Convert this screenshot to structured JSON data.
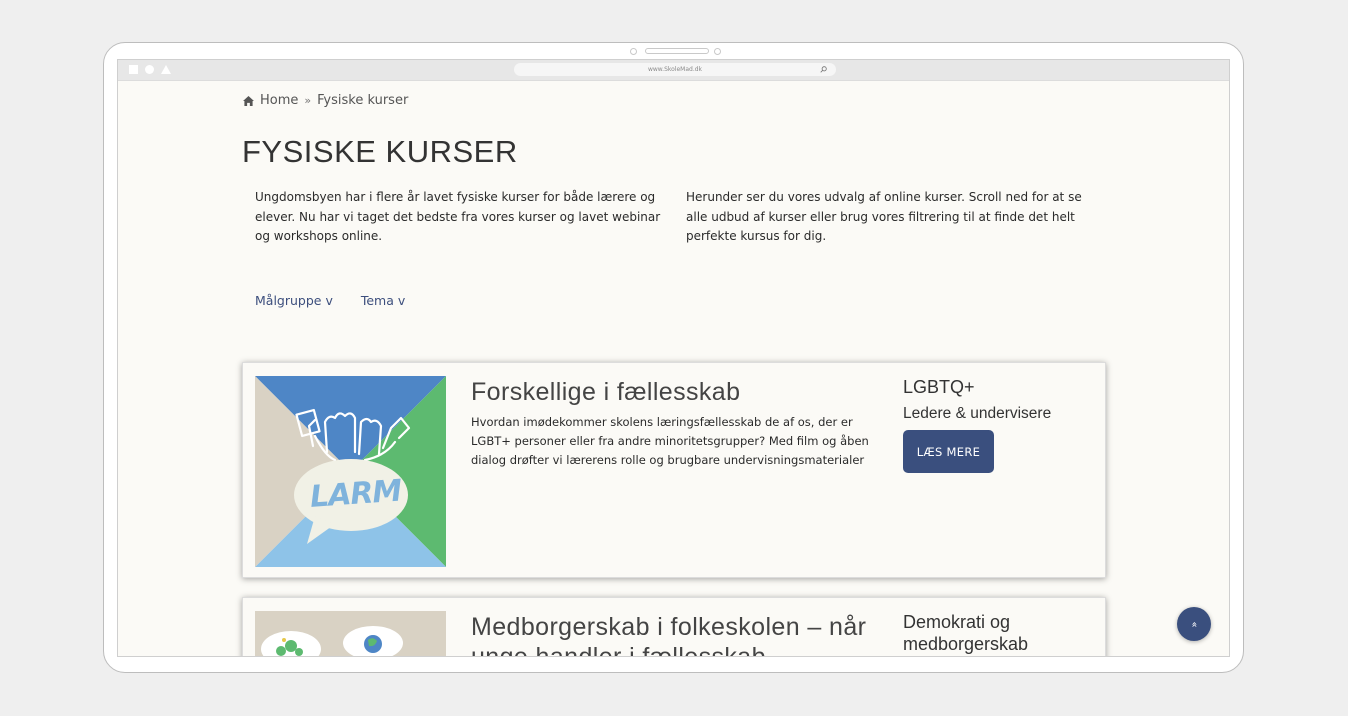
{
  "browser": {
    "url": "www.SkoleMad.dk"
  },
  "breadcrumb": {
    "home_label": "Home",
    "separator": "»",
    "current": "Fysiske kurser"
  },
  "page": {
    "title": "FYSISKE KURSER",
    "intro_left": "Ungdomsbyen har i flere år lavet fysiske kurser for både lærere og elever. Nu har vi taget det bedste fra vores kurser og lavet webinar og workshops online.",
    "intro_right": "Herunder ser du vores udvalg af online kurser. Scroll ned for at se alle udbud af kurser eller brug vores filtrering til at finde det helt perfekte kursus for dig."
  },
  "filters": [
    {
      "label": "Målgruppe v"
    },
    {
      "label": "Tema v"
    }
  ],
  "courses": [
    {
      "image_text": "LARM",
      "title": "Forskellige i fællesskab",
      "description": "Hvordan imødekommer skolens læringsfællesskab de af os, der er LGBT+ personer eller fra andre minoritetsgrupper? Med film og åben dialog drøfter vi lærerens rolle og brugbare undervisningsmaterialer",
      "tag": "LGBTQ+",
      "audience": "Ledere & undervisere",
      "button_label": "LÆS MERE"
    },
    {
      "title": "Medborgerskab i folkeskolen – når unge handler i fællesskab",
      "tag": "Demokrati og medborgerskab"
    }
  ],
  "scroll_top": {
    "icon": "double-chevron-up-icon",
    "glyph": "«"
  },
  "colors": {
    "accent": "#3a4f7e",
    "page_bg": "#fbfaf6",
    "img_blue": "#4e86c6",
    "img_green": "#5dba70",
    "img_light_blue": "#8ec3e8",
    "img_beige": "#d9d2c4"
  }
}
